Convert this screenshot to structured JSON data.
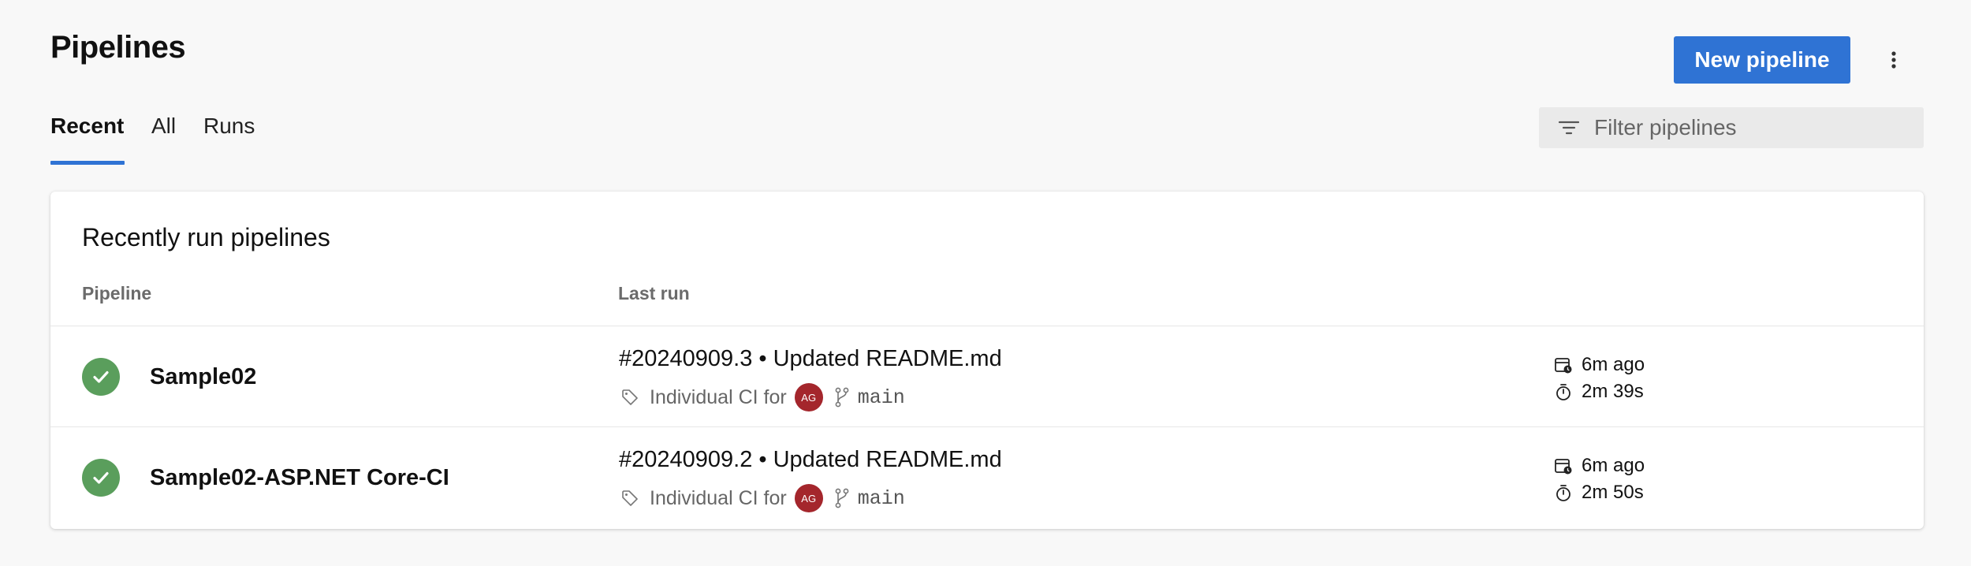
{
  "header": {
    "title": "Pipelines",
    "new_pipeline_label": "New pipeline",
    "more_icon": "more-vertical-icon",
    "accent": "#2f73d4"
  },
  "tabs": [
    {
      "label": "Recent",
      "active": true
    },
    {
      "label": "All",
      "active": false
    },
    {
      "label": "Runs",
      "active": false
    }
  ],
  "filter": {
    "placeholder": "Filter pipelines",
    "icon": "filter-icon"
  },
  "card": {
    "title": "Recently run pipelines",
    "columns": [
      "Pipeline",
      "Last run"
    ]
  },
  "rows": [
    {
      "status": "succeeded",
      "status_color": "#5a9e5c",
      "name": "Sample02",
      "run_title": "#20240909.3 • Updated README.md",
      "trigger": "Individual CI for",
      "avatar_initials": "AG",
      "avatar_color": "#a4262c",
      "branch": "main",
      "time_ago": "6m ago",
      "duration": "2m 39s"
    },
    {
      "status": "succeeded",
      "status_color": "#5a9e5c",
      "name": "Sample02-ASP.NET Core-CI",
      "run_title": "#20240909.2 • Updated README.md",
      "trigger": "Individual CI for",
      "avatar_initials": "AG",
      "avatar_color": "#a4262c",
      "branch": "main",
      "time_ago": "6m ago",
      "duration": "2m 50s"
    }
  ]
}
